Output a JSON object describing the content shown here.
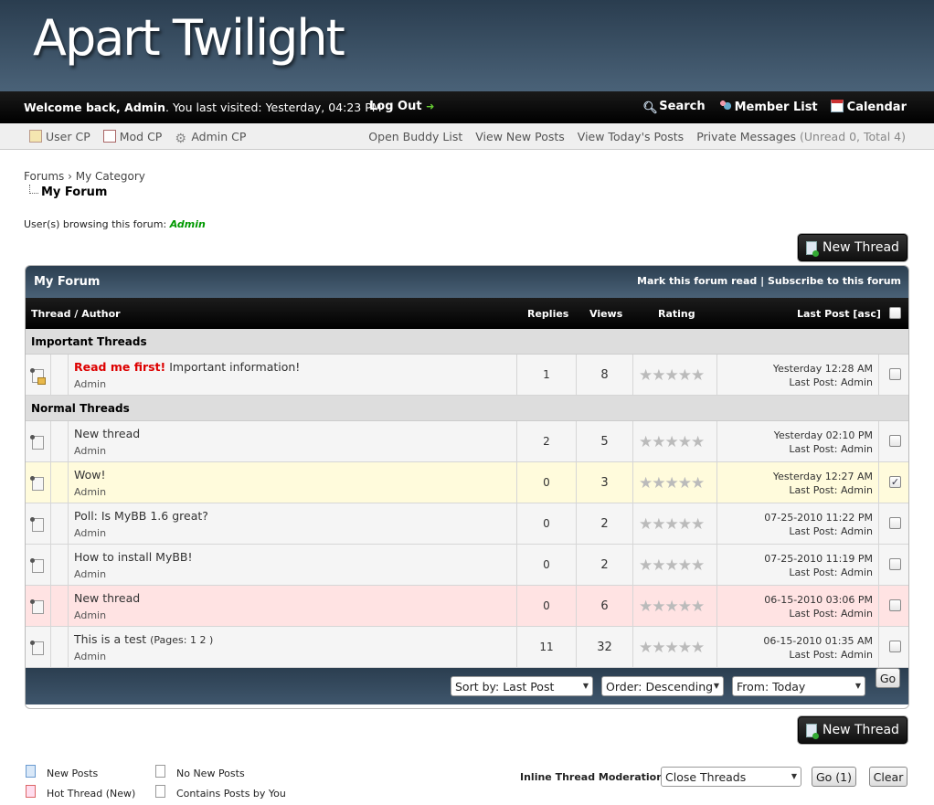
{
  "header": {
    "logo": "Apart Twilight"
  },
  "topbar": {
    "welcome_prefix": "Welcome back, ",
    "username": "Admin",
    "last_visit": ". You last visited: Yesterday, 04:23 PM",
    "logout": "Log Out",
    "search": "Search",
    "member_list": "Member List",
    "calendar": "Calendar"
  },
  "subbar": {
    "user_cp": "User CP",
    "mod_cp": "Mod CP",
    "admin_cp": "Admin CP",
    "buddy": "Open Buddy List",
    "new_posts": "View New Posts",
    "todays": "View Today's Posts",
    "pm": "Private Messages",
    "pm_counts": "(Unread 0, Total 4)"
  },
  "breadcrumb": {
    "forums": "Forums",
    "sep": "›",
    "category": "My Category",
    "current": "My Forum"
  },
  "browsing": {
    "label": "User(s) browsing this forum: ",
    "user": "Admin"
  },
  "new_thread_label": "New Thread",
  "forum": {
    "title": "My Forum",
    "mark_read": "Mark this forum read",
    "divider": "|",
    "subscribe": "Subscribe to this forum",
    "cols": {
      "thread": "Thread / Author",
      "replies": "Replies",
      "views": "Views",
      "rating": "Rating",
      "lastpost": "Last Post [asc]"
    },
    "important": "Important Threads",
    "normal": "Normal Threads",
    "sticky": {
      "hot": "Read me first!",
      "subject": " Important information!",
      "author": "Admin",
      "replies": "1",
      "views": "8",
      "date": "Yesterday 12:28 AM",
      "last": "Last Post: Admin"
    },
    "threads": [
      {
        "subject": "New thread",
        "author": "Admin",
        "replies": "2",
        "views": "5",
        "date": "Yesterday 02:10 PM",
        "last": "Last Post: Admin"
      },
      {
        "subject": "Wow!",
        "author": "Admin",
        "replies": "0",
        "views": "3",
        "date": "Yesterday 12:27 AM",
        "last": "Last Post: Admin"
      },
      {
        "subject": "Poll: Is MyBB 1.6 great?",
        "author": "Admin",
        "replies": "0",
        "views": "2",
        "date": "07-25-2010 11:22 PM",
        "last": "Last Post: Admin"
      },
      {
        "subject": "How to install MyBB!",
        "author": "Admin",
        "replies": "0",
        "views": "2",
        "date": "07-25-2010 11:19 PM",
        "last": "Last Post: Admin"
      },
      {
        "subject": "New thread",
        "author": "Admin",
        "replies": "0",
        "views": "6",
        "date": "06-15-2010 03:06 PM",
        "last": "Last Post: Admin"
      },
      {
        "subject": "This is a test",
        "pages": "(Pages: 1 2 )",
        "author": "Admin",
        "replies": "11",
        "views": "32",
        "date": "06-15-2010 01:35 AM",
        "last": "Last Post: Admin"
      }
    ],
    "stars": "★★★★★",
    "checked": "✓",
    "sort": "Sort by: Last Post",
    "order": "Order: Descending",
    "from": "From: Today",
    "go": "Go"
  },
  "legend": {
    "new_posts": "New Posts",
    "no_new": "No New Posts",
    "hot_new": "Hot Thread (New)",
    "contains": "Contains Posts by You"
  },
  "moderation": {
    "label": "Inline Thread Moderation:",
    "select": "Close Threads",
    "go": "Go (1)",
    "clear": "Clear"
  },
  "colors": {
    "accent_dark": "#2b3e50",
    "hot_red": "#dd0000",
    "online_green": "#009900",
    "selected_row": "#fffbdc",
    "unapproved_row": "#ffe3e3"
  }
}
